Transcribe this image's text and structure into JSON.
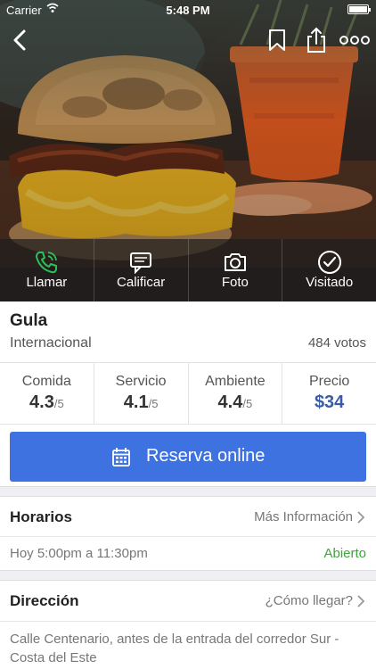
{
  "status_bar": {
    "carrier": "Carrier",
    "time": "5:48 PM",
    "battery_level": 1.0
  },
  "nav": {
    "back_icon": "chevron-left-icon",
    "bookmark_icon": "bookmark-icon",
    "share_icon": "share-icon",
    "more_icon": "more-icon"
  },
  "actions": [
    {
      "label": "Llamar",
      "icon": "phone-icon",
      "color": "#2fbf5a"
    },
    {
      "label": "Calificar",
      "icon": "chat-icon",
      "color": "#ffffff"
    },
    {
      "label": "Foto",
      "icon": "camera-icon",
      "color": "#ffffff"
    },
    {
      "label": "Visitado",
      "icon": "check-circle-icon",
      "color": "#ffffff"
    }
  ],
  "restaurant": {
    "name": "Gula",
    "cuisine": "Internacional",
    "votes": "484 votos"
  },
  "ratings": [
    {
      "label": "Comida",
      "value": "4.3",
      "suffix": "/5"
    },
    {
      "label": "Servicio",
      "value": "4.1",
      "suffix": "/5"
    },
    {
      "label": "Ambiente",
      "value": "4.4",
      "suffix": "/5"
    },
    {
      "label": "Precio",
      "value": "$34",
      "suffix": ""
    }
  ],
  "reserve": {
    "label": "Reserva online",
    "color": "#3d72e0"
  },
  "hours_section": {
    "title": "Horarios",
    "link": "Más Información",
    "hours": "Hoy 5:00pm a 11:30pm",
    "status": "Abierto",
    "status_color": "#3aa63a"
  },
  "address_section": {
    "title": "Dirección",
    "link": "¿Cómo llegar?",
    "address": "Calle Centenario, antes de la entrada del corredor Sur - Costa del Este"
  }
}
